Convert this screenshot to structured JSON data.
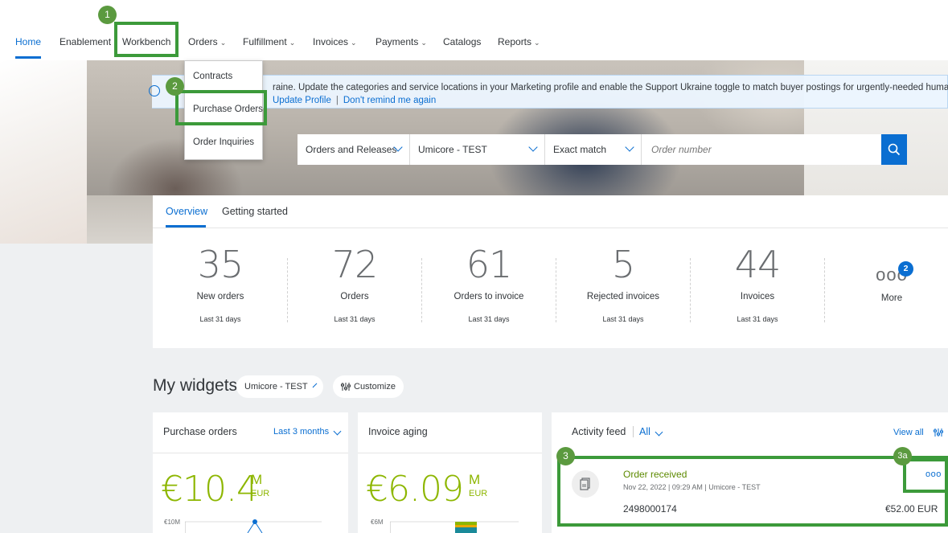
{
  "nav": {
    "home": "Home",
    "enablement": "Enablement",
    "workbench": "Workbench",
    "orders": "Orders",
    "fulfillment": "Fulfillment",
    "invoices": "Invoices",
    "payments": "Payments",
    "catalogs": "Catalogs",
    "reports": "Reports",
    "chevron": "⌄"
  },
  "orders_menu": {
    "items": [
      "Contracts",
      "Purchase Orders",
      "Order Inquiries"
    ]
  },
  "banner": {
    "line1": "raine. Update the categories and service locations in your Marketing profile and enable the Support Ukraine toggle to match buyer postings for urgently-needed humanitarian aid for",
    "update_profile": "Update Profile",
    "separator": "|",
    "dont_remind": "Don't remind me again"
  },
  "search": {
    "type": "Orders and Releases",
    "customer": "Umicore - TEST",
    "match": "Exact match",
    "placeholder": "Order number"
  },
  "overview": {
    "tabs": [
      "Overview",
      "Getting started"
    ],
    "tiles": [
      {
        "value": "35",
        "label": "New orders",
        "period": "Last 31 days"
      },
      {
        "value": "72",
        "label": "Orders",
        "period": "Last 31 days"
      },
      {
        "value": "61",
        "label": "Orders to invoice",
        "period": "Last 31 days"
      },
      {
        "value": "5",
        "label": "Rejected invoices",
        "period": "Last 31 days"
      },
      {
        "value": "44",
        "label": "Invoices",
        "period": "Last 31 days"
      }
    ],
    "more_label": "More",
    "more_count": "2",
    "more_dots": "ooo"
  },
  "widgets": {
    "title": "My widgets",
    "customer": "Umicore - TEST",
    "customize": "Customize",
    "purchase_orders": {
      "title": "Purchase orders",
      "period": "Last 3 months",
      "value": "€10.4",
      "unit": "M",
      "currency": "EUR",
      "axis_top": "€10M"
    },
    "invoice_aging": {
      "title": "Invoice aging",
      "value": "€6.09",
      "unit": "M",
      "currency": "EUR",
      "axis_top": "€6M"
    },
    "activity_feed": {
      "title": "Activity feed",
      "filter": "All",
      "view_all": "View all",
      "item": {
        "title": "Order received",
        "meta": "Nov 22, 2022 | 09:29 AM | Umicore - TEST",
        "order_number": "2498000174",
        "amount": "€52.00 EUR",
        "menu_dots": "ooo"
      }
    }
  },
  "annotations": {
    "step1": "1",
    "step2": "2",
    "step3": "3",
    "step3a": "3a"
  },
  "colors": {
    "accent": "#0a6ed1",
    "highlight": "#3c9a3a",
    "value_green": "#8db600"
  }
}
